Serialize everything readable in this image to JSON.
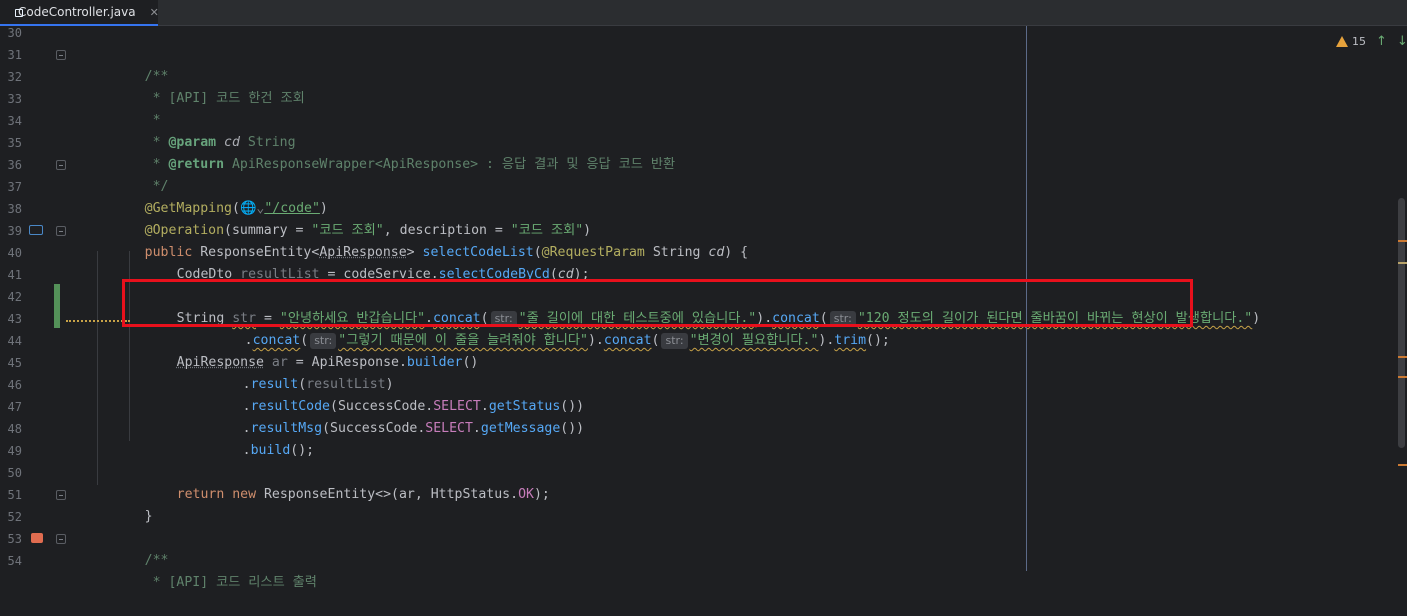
{
  "tab": {
    "title": "CodeController.java",
    "icon": "java-class-icon",
    "close": "✕"
  },
  "status": {
    "warnings": "15",
    "prev": "↑",
    "next": "↓"
  },
  "colors": {
    "accent": "#3574f0",
    "highlight_box": "#e8101c",
    "warning": "#e6a23c"
  },
  "line_numbers": [
    "30",
    "31",
    "32",
    "33",
    "34",
    "35",
    "36",
    "37",
    "38",
    "39",
    "40",
    "41",
    "42",
    "43",
    "44",
    "45",
    "46",
    "47",
    "48",
    "49",
    "50",
    "51",
    "52",
    "53",
    "54"
  ],
  "code": {
    "l31": "/**",
    "l32": " * [API] 코드 한건 조회",
    "l33": " *",
    "l34_star": " * ",
    "l34_tag": "@param",
    "l34_name": " cd",
    "l34_rest": " String",
    "l35_star": " * ",
    "l35_tag": "@return",
    "l35_rest": " ApiResponseWrapper<ApiResponse> : 응답 결과 및 응답 코드 반환",
    "l36": " */",
    "l37_ann": "@GetMapping",
    "l37_paren": "(",
    "l37_globe": "🌐⌄",
    "l37_str": "\"/code\"",
    "l37_close": ")",
    "l38_ann": "@Operation",
    "l38_a": "(summary = ",
    "l38_s1": "\"코드 조회\"",
    "l38_b": ", description = ",
    "l38_s2": "\"코드 조회\"",
    "l38_c": ")",
    "l39_kw": "public ",
    "l39_type": "ResponseEntity<",
    "l39_gen": "ApiResponse",
    "l39_gt": "> ",
    "l39_fn": "selectCodeList",
    "l39_p1": "(",
    "l39_ann": "@RequestParam",
    "l39_p2": " String ",
    "l39_param": "cd",
    "l39_p3": ") {",
    "l40_a": "CodeDto ",
    "l40_var": "resultList",
    "l40_b": " = codeService.",
    "l40_fn": "selectCodeByCd",
    "l40_c": "(",
    "l40_param": "cd",
    "l40_d": ");",
    "l42_a": "String ",
    "l42_var": "str",
    "l42_b": " = ",
    "l42_s1": "\"안녕하세요 반갑습니다\"",
    "l42_dot1": ".",
    "l42_fn1": "concat",
    "l42_p1": "(",
    "l42_hint": "str:",
    "l42_s2": "\"줄 길이에 대한 테스트중에 있습니다.\"",
    "l42_p2": ").",
    "l42_fn2": "concat",
    "l42_p3": "(",
    "l42_s3": "\"120 정도의 길이가 된다면 줄바꿈이 바뀌는 현상이 발생합니다.\"",
    "l42_p4": ")",
    "l43_dot": ".",
    "l43_fn1": "concat",
    "l43_p1": "(",
    "l43_s1": "\"그렇기 때문에 이 줄을 늘려줘야 합니다\"",
    "l43_p2": ").",
    "l43_fn2": "concat",
    "l43_p3": "(",
    "l43_s2": "\"변경이 필요합니다.\"",
    "l43_p4": ").",
    "l43_fn3": "trim",
    "l43_p5": "();",
    "l44_type": "ApiResponse",
    "l44_var": " ar",
    "l44_b": " = ApiResponse.",
    "l44_fn": "builder",
    "l44_c": "()",
    "l45_dot": ".",
    "l45_fn": "result",
    "l45_a": "(",
    "l45_var": "resultList",
    "l45_b": ")",
    "l46_dot": ".",
    "l46_fn": "resultCode",
    "l46_a": "(SuccessCode.",
    "l46_field": "SELECT",
    "l46_dot2": ".",
    "l46_fn2": "getStatus",
    "l46_b": "())",
    "l47_dot": ".",
    "l47_fn": "resultMsg",
    "l47_a": "(SuccessCode.",
    "l47_field": "SELECT",
    "l47_dot2": ".",
    "l47_fn2": "getMessage",
    "l47_b": "())",
    "l48_dot": ".",
    "l48_fn": "build",
    "l48_b": "();",
    "l50_kw1": "return ",
    "l50_kw2": "new ",
    "l50_a": "ResponseEntity<>(ar, HttpStatus.",
    "l50_field": "OK",
    "l50_b": ");",
    "l51": "}",
    "l53": "/**",
    "l54": " * [API] 코드 리스트 출력"
  }
}
